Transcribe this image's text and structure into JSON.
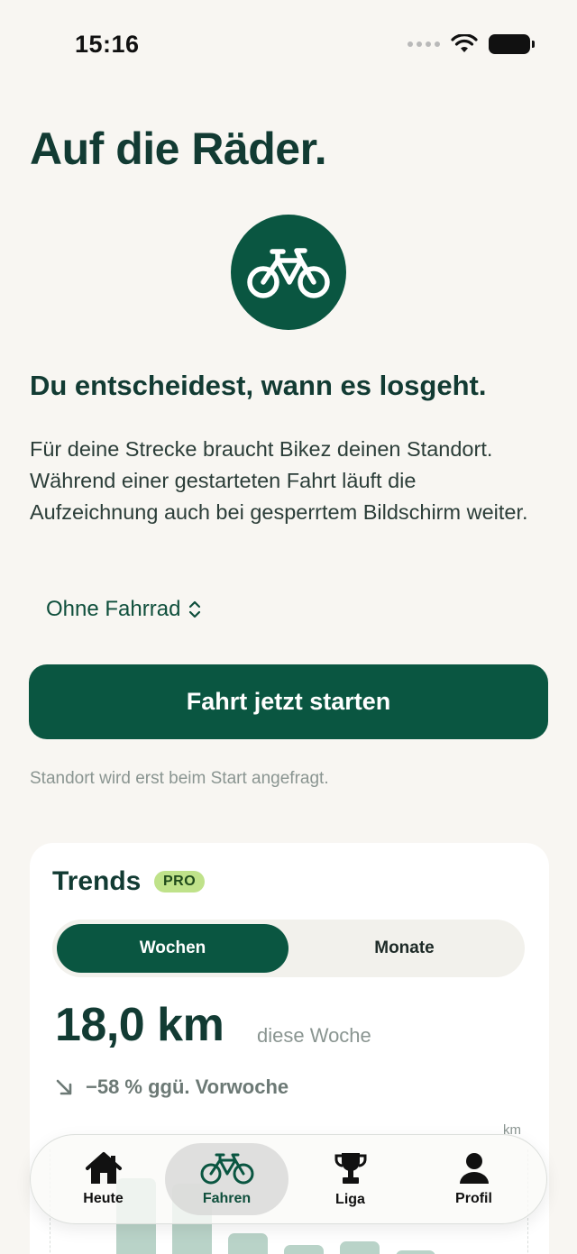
{
  "status": {
    "time": "15:16"
  },
  "page": {
    "title": "Auf die Räder.",
    "headline": "Du entscheidest, wann es losgeht.",
    "body": "Für deine Strecke braucht Bikez deinen Standort. Während einer gestarteten Fahrt läuft die Aufzeichnung auch bei gesperrtem Bildschirm weiter.",
    "bike_picker": "Ohne Fahrrad",
    "start_button": "Fahrt jetzt starten",
    "hint": "Standort wird erst beim Start angefragt."
  },
  "trends": {
    "title": "Trends",
    "badge": "PRO",
    "segments": [
      "Wochen",
      "Monate"
    ],
    "selected_segment": "Wochen",
    "value": "18,0 km",
    "caption": "diese Woche",
    "delta": "−58 % ggü. Vorwoche",
    "unit": "km"
  },
  "chart_data": {
    "type": "bar",
    "values": [
      0.8,
      0.76,
      0.42,
      0.34,
      0.36,
      0.3
    ],
    "ylabel": "km"
  },
  "tabs": [
    {
      "label": "Heute",
      "icon": "house-icon"
    },
    {
      "label": "Fahren",
      "icon": "bicycle-icon"
    },
    {
      "label": "Liga",
      "icon": "trophy-icon"
    },
    {
      "label": "Profil",
      "icon": "person-icon"
    }
  ],
  "active_tab": "Fahren",
  "colors": {
    "brand": "#0a5641",
    "background": "#f8f6f2",
    "badge": "#bfe28a"
  }
}
